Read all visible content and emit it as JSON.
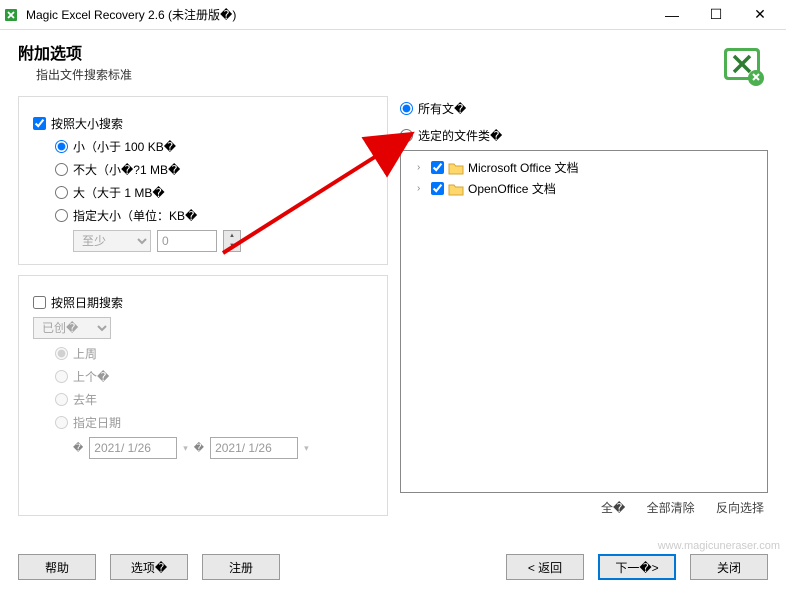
{
  "window": {
    "title": "Magic Excel Recovery 2.6 (未注册版�)"
  },
  "header": {
    "title": "附加选项",
    "subtitle": "指出文件搜索标准"
  },
  "size": {
    "check_label": "按照大小搜索",
    "small": "小（小于 100 KB�",
    "medium": "不大（小�?1 MB�",
    "large": "大（大于 1 MB�",
    "custom": "指定大小（单位：KB�",
    "dropdown": "至少",
    "value": "0"
  },
  "date": {
    "check_label": "按照日期搜索",
    "dropdown": "已创�",
    "last_week": "上周",
    "last_month": "上个�",
    "last_year": "去年",
    "custom": "指定日期",
    "from": "2021/ 1/26",
    "to": "2021/ 1/26"
  },
  "filetype": {
    "all": "所有文�",
    "selected": "选定的文件类�",
    "tree": {
      "ms": "Microsoft Office 文档",
      "oo": "OpenOffice 文档"
    },
    "link_all": "全�",
    "link_clear": "全部清除",
    "link_invert": "反向选择"
  },
  "buttons": {
    "help": "帮助",
    "options": "选项�",
    "register": "注册",
    "back": "< 返回",
    "next": "下一�>",
    "close": "关闭"
  },
  "watermark": "www.magicuneraser.com"
}
